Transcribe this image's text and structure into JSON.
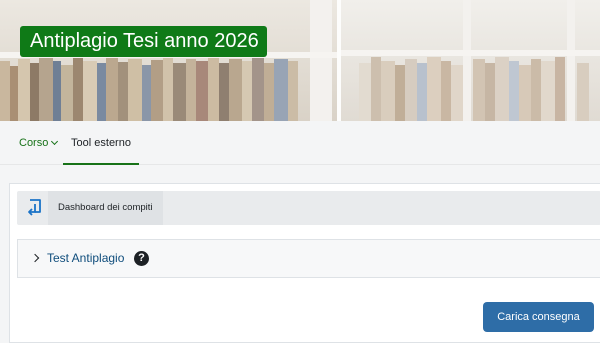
{
  "banner": {
    "title": "Antiplagio Tesi anno 2026"
  },
  "nav": {
    "tabs": [
      {
        "label": "Corso",
        "has_dropdown": true,
        "active": false
      },
      {
        "label": "Tool esterno",
        "active": true
      }
    ]
  },
  "main": {
    "dashboard_button": "Dashboard dei compiti",
    "section": {
      "title": "Test Antiplagio",
      "help_glyph": "?"
    },
    "submit_button": "Carica consegna"
  },
  "colors": {
    "brand_green": "#0f7a17",
    "primary_blue": "#2e6da7",
    "link_blue": "#0f4d7c"
  },
  "icons": {
    "dashboard": "return-arrow-icon",
    "help": "question-circle-icon",
    "chevron": "chevron-down-icon",
    "expand": "chevron-right-icon"
  }
}
